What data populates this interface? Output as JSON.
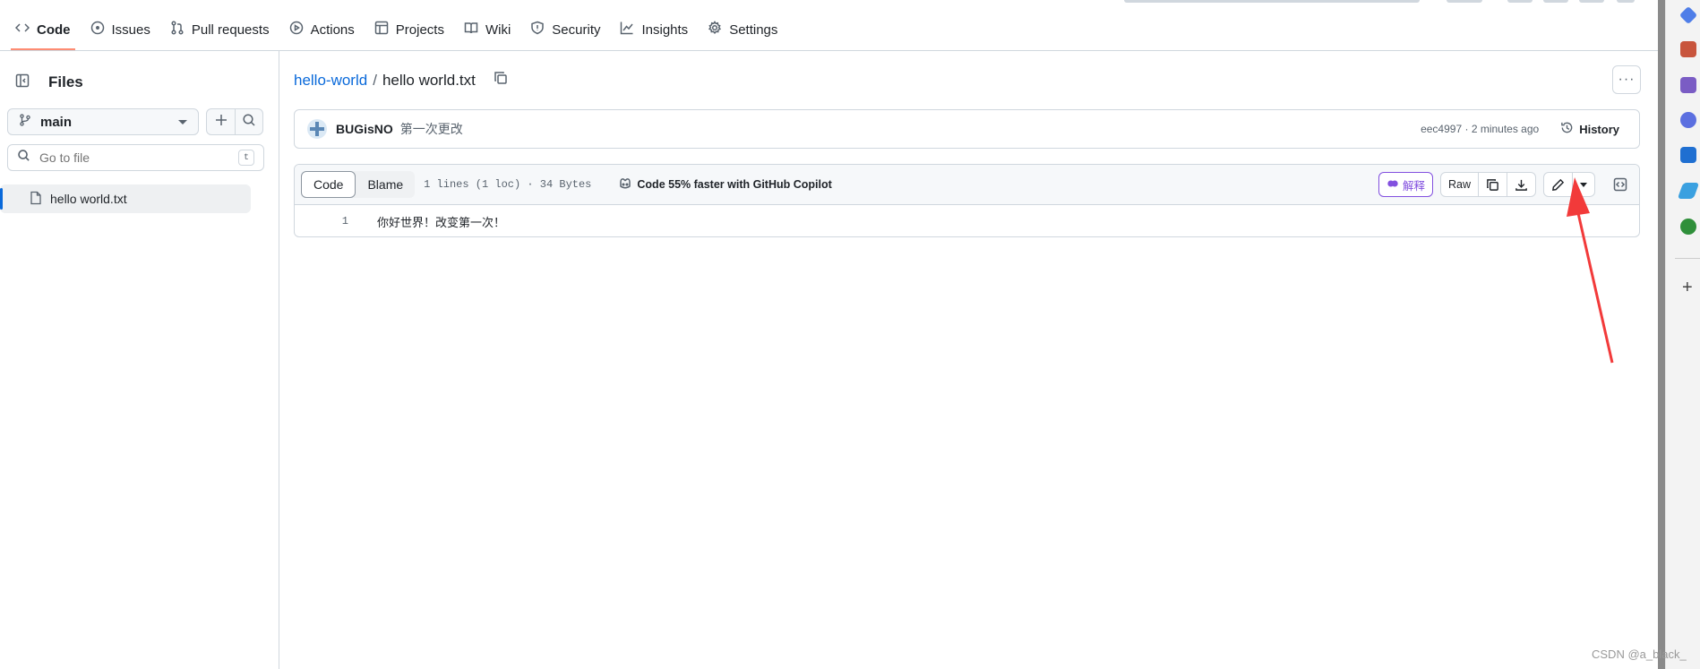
{
  "nav": {
    "tabs": [
      {
        "label": "Code",
        "icon": "code-icon",
        "active": true
      },
      {
        "label": "Issues",
        "icon": "issue-icon"
      },
      {
        "label": "Pull requests",
        "icon": "pull-request-icon"
      },
      {
        "label": "Actions",
        "icon": "play-icon"
      },
      {
        "label": "Projects",
        "icon": "table-icon"
      },
      {
        "label": "Wiki",
        "icon": "book-icon"
      },
      {
        "label": "Security",
        "icon": "shield-icon"
      },
      {
        "label": "Insights",
        "icon": "graph-icon"
      },
      {
        "label": "Settings",
        "icon": "gear-icon"
      }
    ]
  },
  "sidebar": {
    "title": "Files",
    "branch": "main",
    "search_placeholder": "Go to file",
    "search_shortcut": "t",
    "files": [
      {
        "name": "hello world.txt",
        "selected": true
      }
    ]
  },
  "breadcrumb": {
    "repo": "hello-world",
    "separator": "/",
    "file": "hello world.txt"
  },
  "commit": {
    "author": "BUGisNO",
    "message": "第一次更改",
    "sha": "eec4997",
    "dot": "·",
    "time": "2 minutes ago",
    "history_label": "History"
  },
  "file_view": {
    "view_code": "Code",
    "view_blame": "Blame",
    "meta": "1 lines (1 loc) · 34 Bytes",
    "copilot": "Code 55% faster with GitHub Copilot",
    "explain_label": "解释",
    "raw_label": "Raw",
    "lines": [
      {
        "num": "1",
        "text": "你好世界！改变第一次！"
      }
    ]
  },
  "watermark": "CSDN @a_black_",
  "colors": {
    "link": "#0969da",
    "tab_underline": "#fd8c73",
    "explain": "#8250df",
    "arrow": "#f23a3a"
  }
}
